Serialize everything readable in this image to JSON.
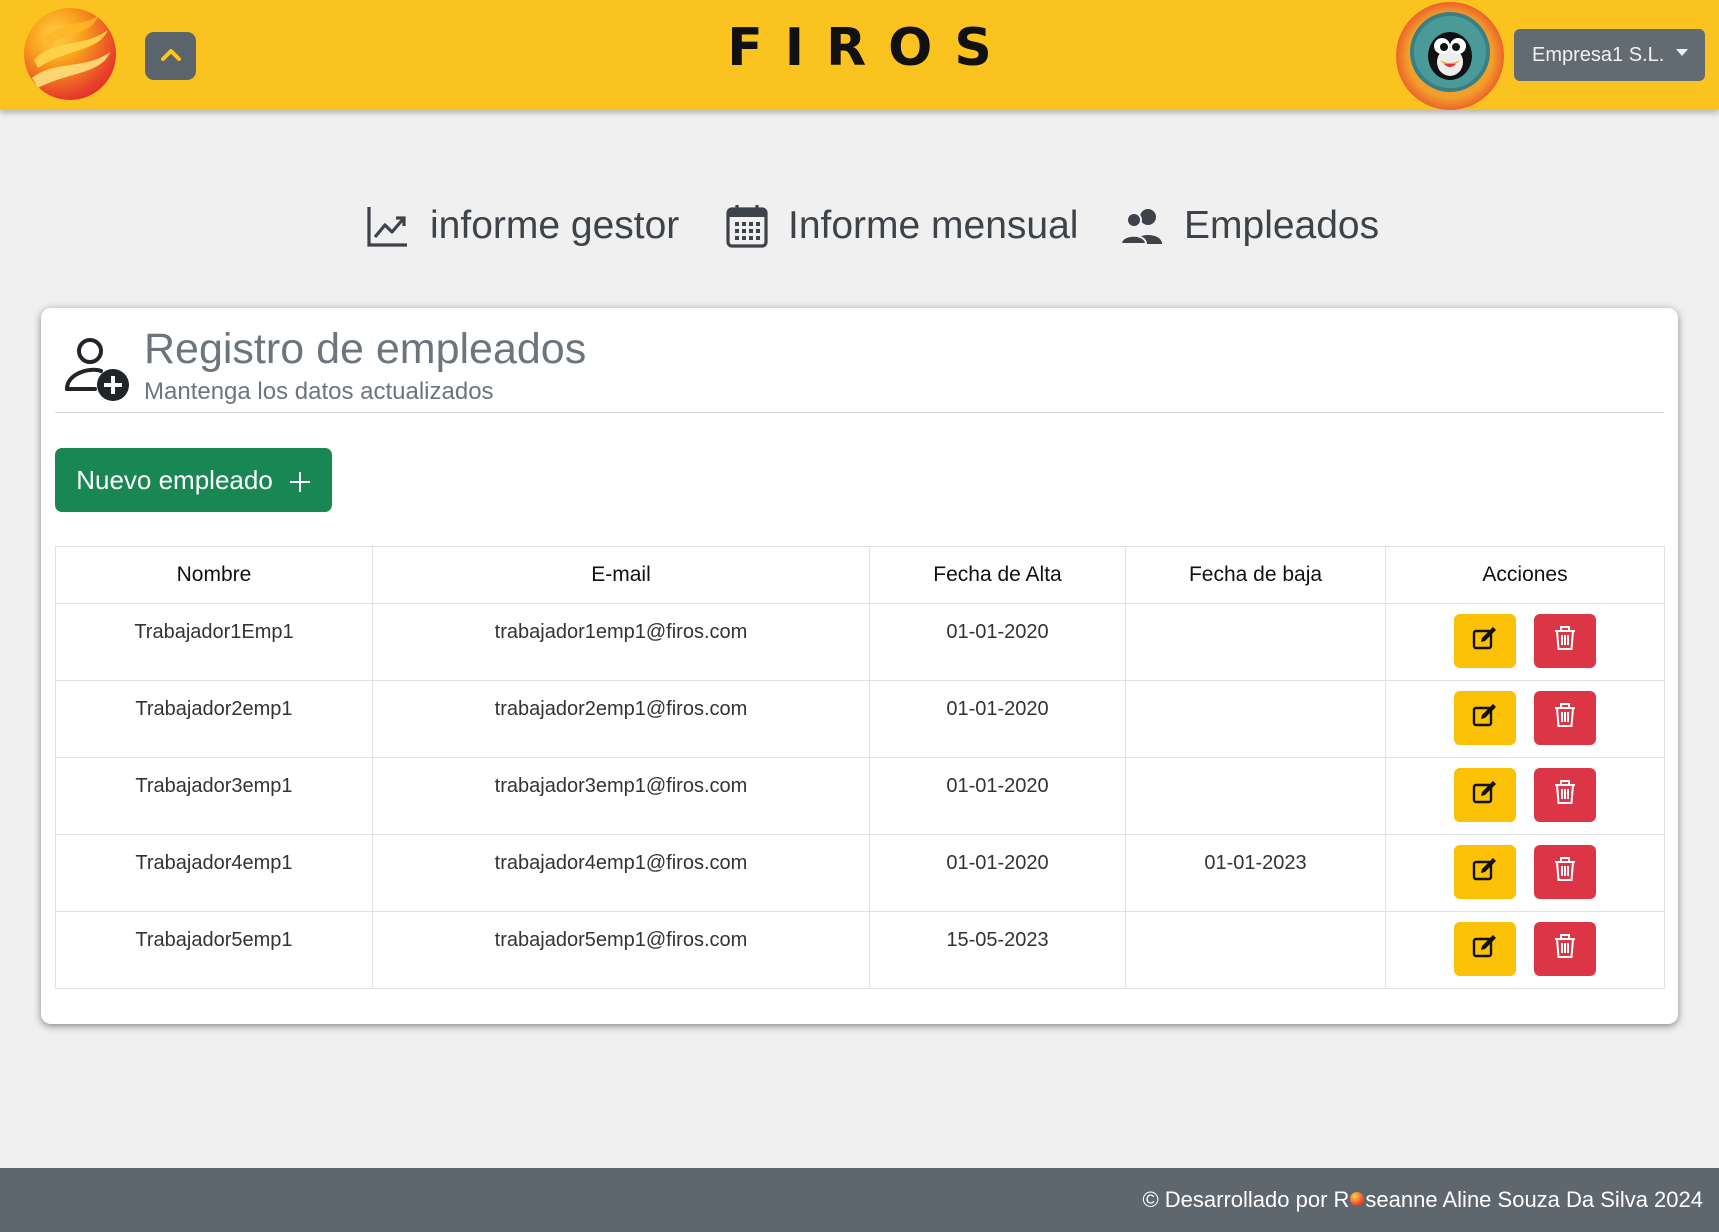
{
  "header": {
    "brand": "FIROS",
    "company_selector": "Empresa1 S.L.",
    "colors": {
      "bar": "#fbc320",
      "dropdown": "#626a72"
    }
  },
  "nav": {
    "items": [
      {
        "label": "informe gestor",
        "icon": "trend-chart-icon"
      },
      {
        "label": "Informe mensual",
        "icon": "calendar-icon"
      },
      {
        "label": "Empleados",
        "icon": "users-icon"
      }
    ]
  },
  "card": {
    "title": "Registro de empleados",
    "subtitle": "Mantenga los datos actualizados",
    "icon": "user-add-icon",
    "new_button": "Nuevo empleado",
    "new_button_icon": "plus-icon"
  },
  "table": {
    "headers": [
      "Nombre",
      "E-mail",
      "Fecha de Alta",
      "Fecha de baja",
      "Acciones"
    ],
    "rows": [
      {
        "nombre": "Trabajador1Emp1",
        "email": "trabajador1emp1@firos.com",
        "alta": "01-01-2020",
        "baja": ""
      },
      {
        "nombre": "Trabajador2emp1",
        "email": "trabajador2emp1@firos.com",
        "alta": "01-01-2020",
        "baja": ""
      },
      {
        "nombre": "Trabajador3emp1",
        "email": "trabajador3emp1@firos.com",
        "alta": "01-01-2020",
        "baja": ""
      },
      {
        "nombre": "Trabajador4emp1",
        "email": "trabajador4emp1@firos.com",
        "alta": "01-01-2020",
        "baja": "01-01-2023"
      },
      {
        "nombre": "Trabajador5emp1",
        "email": "trabajador5emp1@firos.com",
        "alta": "15-05-2023",
        "baja": ""
      }
    ],
    "action_icons": {
      "edit": "edit-icon",
      "delete": "trash-icon"
    },
    "colors": {
      "edit": "#fbc107",
      "delete": "#dc3545"
    }
  },
  "footer": {
    "text_before": "© Desarrollado por R",
    "text_after": "seanne Aline Souza Da Silva 2024"
  }
}
